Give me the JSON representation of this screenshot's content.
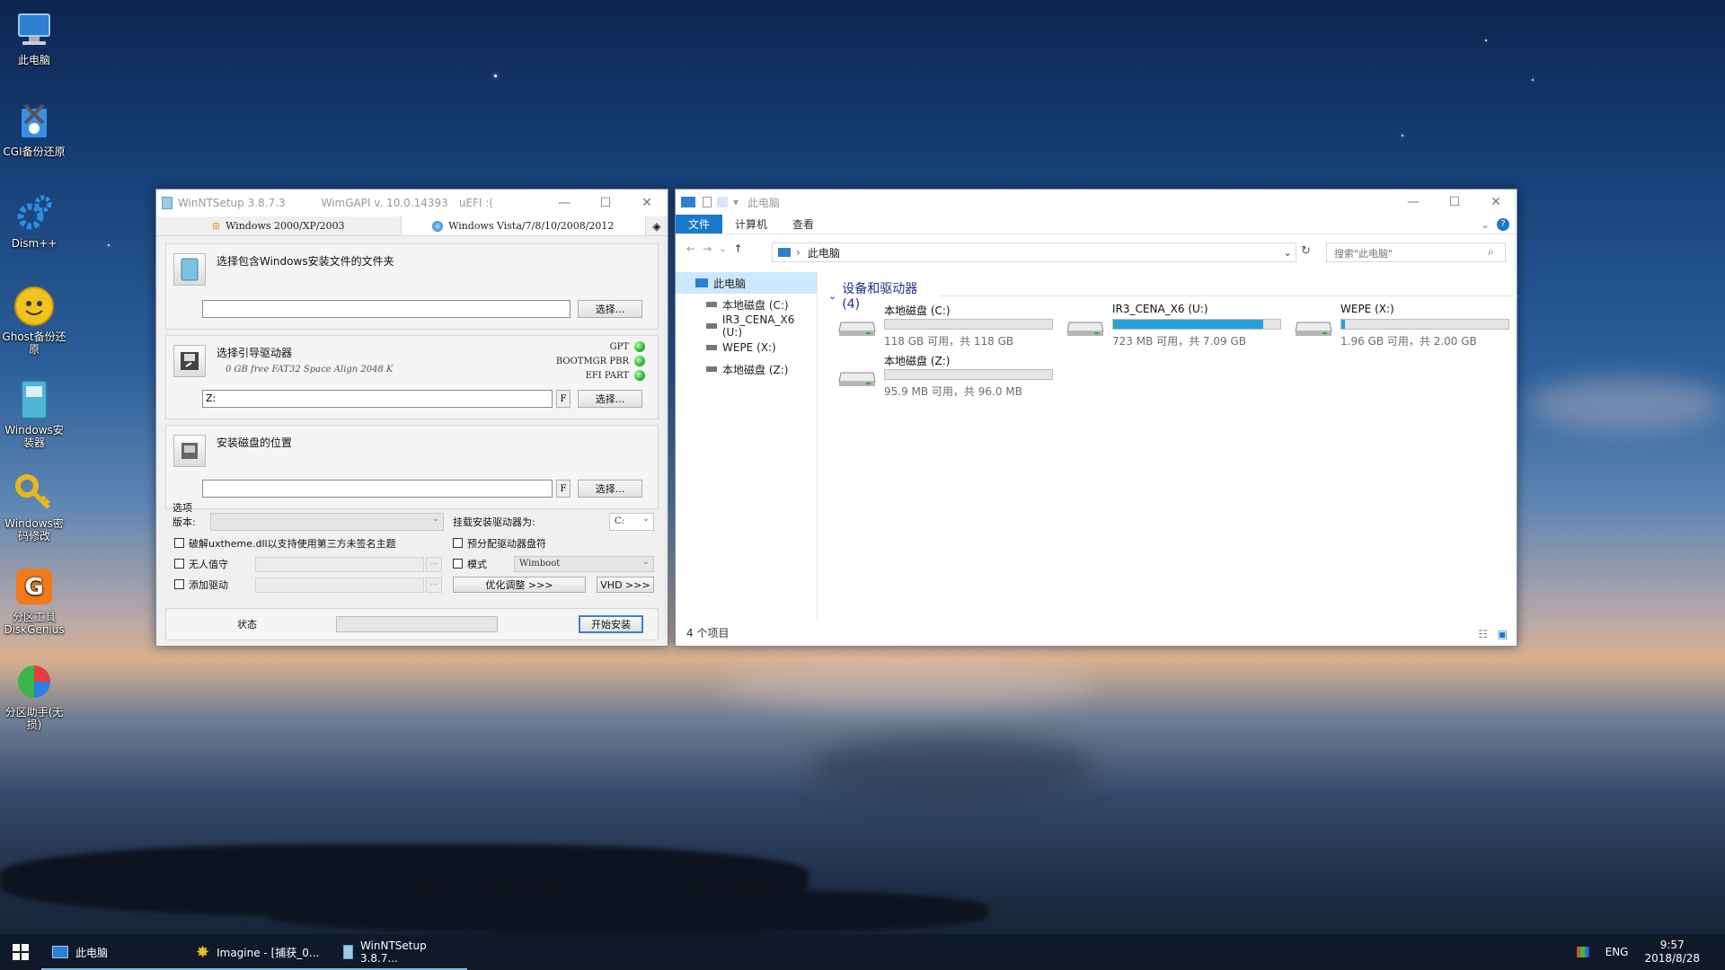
{
  "desktop": {
    "icons": [
      {
        "label": "此电脑"
      },
      {
        "label": "CGI备份还原"
      },
      {
        "label": "Dism++"
      },
      {
        "label": "Ghost备份还原"
      },
      {
        "label": "Windows安装器"
      },
      {
        "label": "Windows密码修改"
      },
      {
        "label": "分区工具DiskGenius"
      },
      {
        "label": "分区助手(无损)"
      }
    ]
  },
  "winntsetup": {
    "title": "WinNTSetup 3.8.7.3",
    "wimgapi": "WimGAPI v. 10.0.14393",
    "uefi": "uEFI :(",
    "tabs": [
      "Windows 2000/XP/2003",
      "Windows Vista/7/8/10/2008/2012"
    ],
    "source": {
      "label": "选择包含Windows安装文件的文件夹",
      "value": "",
      "button": "选择..."
    },
    "boot": {
      "label": "选择引导驱动器",
      "sub": "0 GB free FAT32 Space Align 2048 K",
      "value": "Z:",
      "f": "F",
      "button": "选择...",
      "status": [
        "GPT",
        "BOOTMGR PBR",
        "EFI PART"
      ]
    },
    "install": {
      "label": "安装磁盘的位置",
      "value": "",
      "f": "F",
      "button": "选择..."
    },
    "options": {
      "title": "选项",
      "version_label": "版本:",
      "mount_label": "挂载安装驱动器为:",
      "mount_value": "C:",
      "uxtheme": "破解uxtheme.dll以支持使用第三方未签名主题",
      "prealloc": "预分配驱动器盘符",
      "unattended": "无人值守",
      "mode": "模式",
      "mode_value": "Wimboot",
      "add_driver": "添加驱动",
      "tweaks_button": "优化调整 >>>",
      "vhd_button": "VHD >>>",
      "ellipsis": "..."
    },
    "footer": {
      "status_label": "状态",
      "start_button": "开始安装"
    }
  },
  "explorer": {
    "title": "此电脑",
    "ribbon_tabs": [
      "文件",
      "计算机",
      "查看"
    ],
    "address": "此电脑",
    "search_placeholder": "搜索\"此电脑\"",
    "nav": [
      "此电脑",
      "本地磁盘 (C:)",
      "IR3_CENA_X6 (U:)",
      "WEPE (X:)",
      "本地磁盘 (Z:)"
    ],
    "section": "设备和驱动器 (4)",
    "drives": [
      {
        "name": "本地磁盘 (C:)",
        "free": "118 GB 可用，共 118 GB",
        "used_fraction": 0.0
      },
      {
        "name": "IR3_CENA_X6 (U:)",
        "free": "723 MB 可用，共 7.09 GB",
        "used_fraction": 0.9
      },
      {
        "name": "WEPE (X:)",
        "free": "1.96 GB 可用，共 2.00 GB",
        "used_fraction": 0.02
      },
      {
        "name": "本地磁盘 (Z:)",
        "free": "95.9 MB 可用，共 96.0 MB",
        "used_fraction": 0.0
      }
    ],
    "status": "4 个项目"
  },
  "taskbar": {
    "items": [
      "此电脑",
      "Imagine - [捕获_0...",
      "WinNTSetup 3.8.7..."
    ],
    "lang": "ENG",
    "time": "9:57",
    "date": "2018/8/28"
  }
}
